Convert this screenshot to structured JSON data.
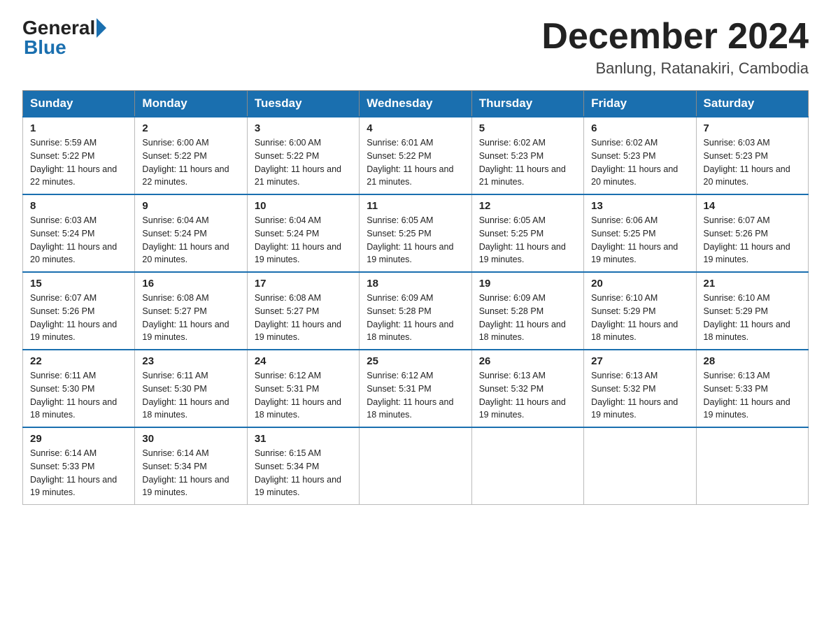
{
  "header": {
    "logo_general": "General",
    "logo_blue": "Blue",
    "month_title": "December 2024",
    "location": "Banlung, Ratanakiri, Cambodia"
  },
  "days_of_week": [
    "Sunday",
    "Monday",
    "Tuesday",
    "Wednesday",
    "Thursday",
    "Friday",
    "Saturday"
  ],
  "weeks": [
    [
      {
        "day": "1",
        "sunrise": "5:59 AM",
        "sunset": "5:22 PM",
        "daylight": "11 hours and 22 minutes."
      },
      {
        "day": "2",
        "sunrise": "6:00 AM",
        "sunset": "5:22 PM",
        "daylight": "11 hours and 22 minutes."
      },
      {
        "day": "3",
        "sunrise": "6:00 AM",
        "sunset": "5:22 PM",
        "daylight": "11 hours and 21 minutes."
      },
      {
        "day": "4",
        "sunrise": "6:01 AM",
        "sunset": "5:22 PM",
        "daylight": "11 hours and 21 minutes."
      },
      {
        "day": "5",
        "sunrise": "6:02 AM",
        "sunset": "5:23 PM",
        "daylight": "11 hours and 21 minutes."
      },
      {
        "day": "6",
        "sunrise": "6:02 AM",
        "sunset": "5:23 PM",
        "daylight": "11 hours and 20 minutes."
      },
      {
        "day": "7",
        "sunrise": "6:03 AM",
        "sunset": "5:23 PM",
        "daylight": "11 hours and 20 minutes."
      }
    ],
    [
      {
        "day": "8",
        "sunrise": "6:03 AM",
        "sunset": "5:24 PM",
        "daylight": "11 hours and 20 minutes."
      },
      {
        "day": "9",
        "sunrise": "6:04 AM",
        "sunset": "5:24 PM",
        "daylight": "11 hours and 20 minutes."
      },
      {
        "day": "10",
        "sunrise": "6:04 AM",
        "sunset": "5:24 PM",
        "daylight": "11 hours and 19 minutes."
      },
      {
        "day": "11",
        "sunrise": "6:05 AM",
        "sunset": "5:25 PM",
        "daylight": "11 hours and 19 minutes."
      },
      {
        "day": "12",
        "sunrise": "6:05 AM",
        "sunset": "5:25 PM",
        "daylight": "11 hours and 19 minutes."
      },
      {
        "day": "13",
        "sunrise": "6:06 AM",
        "sunset": "5:25 PM",
        "daylight": "11 hours and 19 minutes."
      },
      {
        "day": "14",
        "sunrise": "6:07 AM",
        "sunset": "5:26 PM",
        "daylight": "11 hours and 19 minutes."
      }
    ],
    [
      {
        "day": "15",
        "sunrise": "6:07 AM",
        "sunset": "5:26 PM",
        "daylight": "11 hours and 19 minutes."
      },
      {
        "day": "16",
        "sunrise": "6:08 AM",
        "sunset": "5:27 PM",
        "daylight": "11 hours and 19 minutes."
      },
      {
        "day": "17",
        "sunrise": "6:08 AM",
        "sunset": "5:27 PM",
        "daylight": "11 hours and 19 minutes."
      },
      {
        "day": "18",
        "sunrise": "6:09 AM",
        "sunset": "5:28 PM",
        "daylight": "11 hours and 18 minutes."
      },
      {
        "day": "19",
        "sunrise": "6:09 AM",
        "sunset": "5:28 PM",
        "daylight": "11 hours and 18 minutes."
      },
      {
        "day": "20",
        "sunrise": "6:10 AM",
        "sunset": "5:29 PM",
        "daylight": "11 hours and 18 minutes."
      },
      {
        "day": "21",
        "sunrise": "6:10 AM",
        "sunset": "5:29 PM",
        "daylight": "11 hours and 18 minutes."
      }
    ],
    [
      {
        "day": "22",
        "sunrise": "6:11 AM",
        "sunset": "5:30 PM",
        "daylight": "11 hours and 18 minutes."
      },
      {
        "day": "23",
        "sunrise": "6:11 AM",
        "sunset": "5:30 PM",
        "daylight": "11 hours and 18 minutes."
      },
      {
        "day": "24",
        "sunrise": "6:12 AM",
        "sunset": "5:31 PM",
        "daylight": "11 hours and 18 minutes."
      },
      {
        "day": "25",
        "sunrise": "6:12 AM",
        "sunset": "5:31 PM",
        "daylight": "11 hours and 18 minutes."
      },
      {
        "day": "26",
        "sunrise": "6:13 AM",
        "sunset": "5:32 PM",
        "daylight": "11 hours and 19 minutes."
      },
      {
        "day": "27",
        "sunrise": "6:13 AM",
        "sunset": "5:32 PM",
        "daylight": "11 hours and 19 minutes."
      },
      {
        "day": "28",
        "sunrise": "6:13 AM",
        "sunset": "5:33 PM",
        "daylight": "11 hours and 19 minutes."
      }
    ],
    [
      {
        "day": "29",
        "sunrise": "6:14 AM",
        "sunset": "5:33 PM",
        "daylight": "11 hours and 19 minutes."
      },
      {
        "day": "30",
        "sunrise": "6:14 AM",
        "sunset": "5:34 PM",
        "daylight": "11 hours and 19 minutes."
      },
      {
        "day": "31",
        "sunrise": "6:15 AM",
        "sunset": "5:34 PM",
        "daylight": "11 hours and 19 minutes."
      },
      null,
      null,
      null,
      null
    ]
  ]
}
